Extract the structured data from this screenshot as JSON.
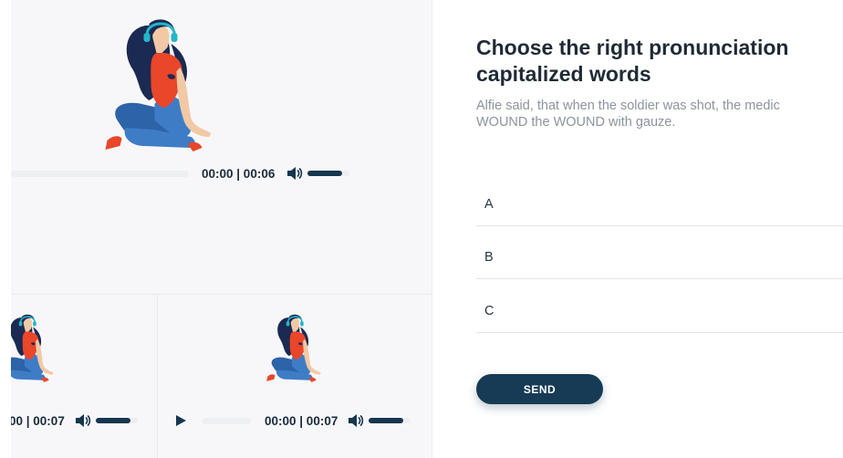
{
  "colors": {
    "accent": "#173a55",
    "panel_bg": "#f7f7fa",
    "hair": "#1a2a52",
    "shirt": "#e9462a",
    "jeans": "#3f7cc6",
    "headphones": "#25b5c8",
    "skin": "#f1c9a5"
  },
  "players": [
    {
      "time": "00:00 | 00:06",
      "volume_icon": "speaker-icon",
      "volume_level": 1.0
    },
    {
      "time": "00 | 00:07",
      "volume_icon": "speaker-icon",
      "volume_level": 1.0
    },
    {
      "time": "00:00 | 00:07",
      "play_icon": "play-icon",
      "volume_icon": "speaker-icon",
      "volume_level": 1.0
    }
  ],
  "question": {
    "title": "Choose the right pronunciation\ncapitalized words",
    "text": "Alfie said, that when the soldier was shot, the medic WOUND the WOUND with gauze."
  },
  "options": [
    {
      "label": "A"
    },
    {
      "label": "B"
    },
    {
      "label": "C"
    }
  ],
  "send_label": "SEND"
}
